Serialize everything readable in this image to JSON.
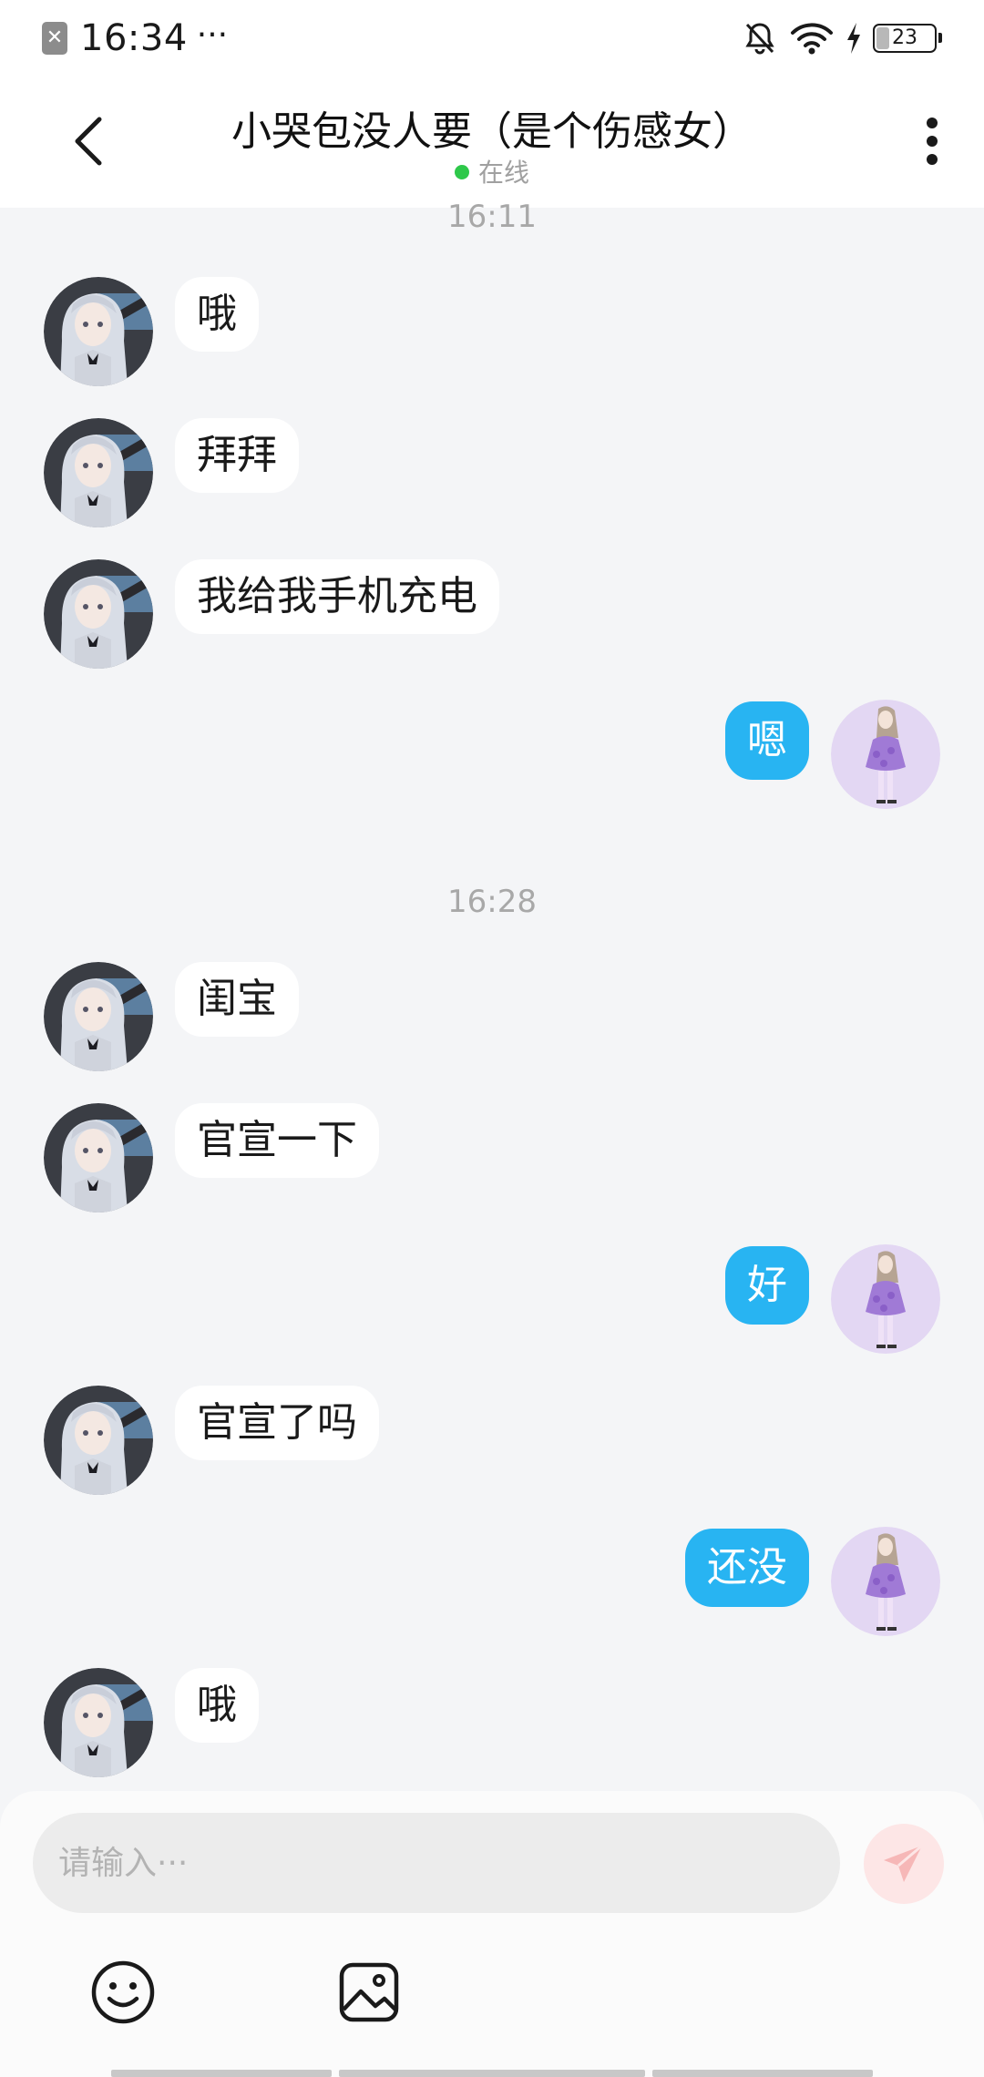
{
  "status_bar": {
    "time": "16:34",
    "dots": "···",
    "battery": "23",
    "icons": [
      "sim-error-icon",
      "bell-muted-icon",
      "wifi-icon",
      "charging-icon",
      "battery-icon"
    ]
  },
  "header": {
    "title": "小哭包没人要（是个伤感女）",
    "status": "在线",
    "status_color": "#2ec84a",
    "icons": [
      "back-arrow-icon",
      "more-vertical-icon"
    ]
  },
  "conversation": {
    "time_1": "16:11",
    "time_2": "16:28",
    "messages": [
      {
        "from": "other",
        "text": "哦"
      },
      {
        "from": "other",
        "text": "拜拜"
      },
      {
        "from": "other",
        "text": "我给我手机充电"
      },
      {
        "from": "me",
        "text": "嗯"
      },
      {
        "from": "other",
        "text": "闺宝"
      },
      {
        "from": "other",
        "text": "官宣一下"
      },
      {
        "from": "me",
        "text": "好"
      },
      {
        "from": "other",
        "text": "官宣了吗"
      },
      {
        "from": "me",
        "text": "还没"
      },
      {
        "from": "other",
        "text": "哦"
      }
    ]
  },
  "composer": {
    "placeholder": "请输入···",
    "icons": [
      "send-icon",
      "emoji-icon",
      "image-icon"
    ]
  },
  "colors": {
    "background": "#f4f5f7",
    "outgoing_bubble": "#28b4f2",
    "incoming_bubble": "#ffffff",
    "send_button": "#fde6e6"
  }
}
